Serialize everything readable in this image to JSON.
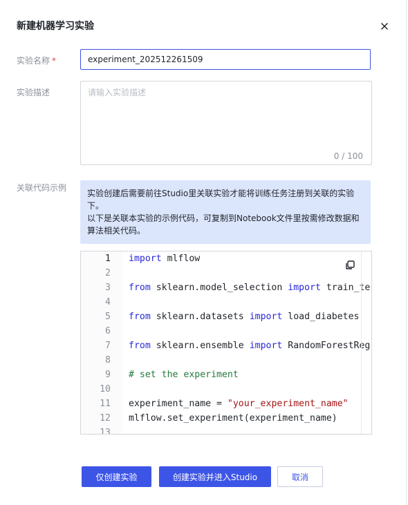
{
  "dialog": {
    "title": "新建机器学习实验",
    "close_icon": "close-icon"
  },
  "form": {
    "name_label": "实验名称",
    "name_required": "*",
    "name_value": "experiment_202512261509",
    "desc_label": "实验描述",
    "desc_placeholder": "请输入实验描述",
    "desc_counter": "0 / 100",
    "code_label": "关联代码示例"
  },
  "info": {
    "line1": "实验创建后需要前往Studio里关联实验才能将训练任务注册到关联的实验下。",
    "line2": "以下是关联本实验的示例代码，可复制到Notebook文件里按需修改数据和算法相关代码。"
  },
  "code": {
    "copy_icon": "copy-icon",
    "active_line": 1,
    "lines": [
      [
        {
          "t": "kw",
          "v": "import"
        },
        {
          "t": "",
          "v": " mlflow"
        }
      ],
      [],
      [
        {
          "t": "kw",
          "v": "from"
        },
        {
          "t": "",
          "v": " sklearn.model_selection "
        },
        {
          "t": "kw",
          "v": "import"
        },
        {
          "t": "",
          "v": " train_test_split"
        }
      ],
      [],
      [
        {
          "t": "kw",
          "v": "from"
        },
        {
          "t": "",
          "v": " sklearn.datasets "
        },
        {
          "t": "kw",
          "v": "import"
        },
        {
          "t": "",
          "v": " load_diabetes"
        }
      ],
      [],
      [
        {
          "t": "kw",
          "v": "from"
        },
        {
          "t": "",
          "v": " sklearn.ensemble "
        },
        {
          "t": "kw",
          "v": "import"
        },
        {
          "t": "",
          "v": " RandomForestRegressor"
        }
      ],
      [],
      [
        {
          "t": "cm",
          "v": "# set the experiment"
        }
      ],
      [],
      [
        {
          "t": "",
          "v": "experiment_name = "
        },
        {
          "t": "str",
          "v": "\"your_experiment_name\""
        }
      ],
      [
        {
          "t": "",
          "v": "mlflow.set_experiment(experiment_name)"
        }
      ],
      []
    ]
  },
  "footer": {
    "create_label": "仅创建实验",
    "create_studio_label": "创建实验并进入Studio",
    "cancel_label": "取消"
  }
}
